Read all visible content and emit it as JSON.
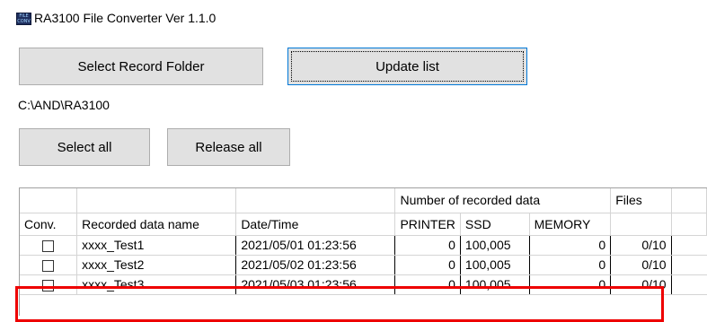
{
  "window": {
    "title": "RA3100 File Converter Ver 1.1.0",
    "icon_name": "file-converter-app-icon",
    "icon_text": "FILE CONV"
  },
  "toolbar": {
    "select_folder_label": "Select Record Folder",
    "update_list_label": "Update list"
  },
  "folder_path": "C:\\AND\\RA3100",
  "selection": {
    "select_all_label": "Select all",
    "release_all_label": "Release all"
  },
  "grid": {
    "group_headers": {
      "number_of_recorded_data": "Number of recorded data",
      "files": "Files"
    },
    "columns": {
      "conv": "Conv.",
      "name": "Recorded data name",
      "datetime": "Date/Time",
      "printer": "PRINTER",
      "ssd": "SSD",
      "memory": "MEMORY"
    },
    "rows": [
      {
        "checked": false,
        "name": "xxxx_Test1",
        "datetime": "2021/05/01 01:23:56",
        "printer": "0",
        "ssd": "100,005",
        "memory": "0",
        "files": "0/10"
      },
      {
        "checked": false,
        "name": "xxxx_Test2",
        "datetime": "2021/05/02 01:23:56",
        "printer": "0",
        "ssd": "100,005",
        "memory": "0",
        "files": "0/10"
      },
      {
        "checked": false,
        "name": "xxxx_Test3",
        "datetime": "2021/05/03 01:23:56",
        "printer": "0",
        "ssd": "100,005",
        "memory": "0",
        "files": "0/10"
      }
    ]
  },
  "colors": {
    "highlight": "#ee0000",
    "button_bg": "#e1e1e1",
    "focus_border": "#0078d7"
  }
}
